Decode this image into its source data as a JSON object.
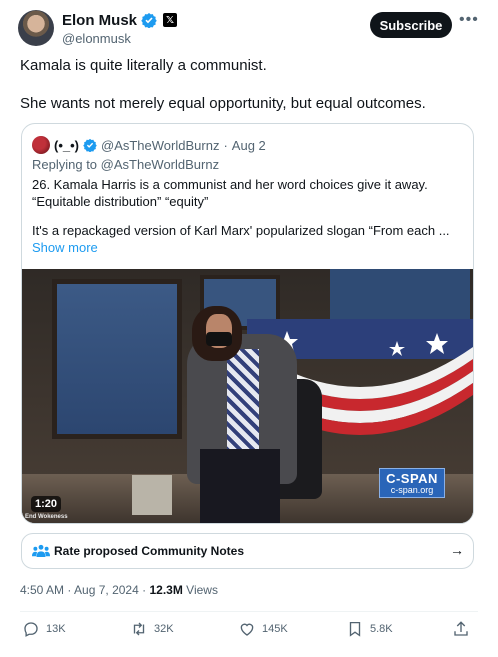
{
  "author": {
    "display_name": "Elon Musk",
    "handle": "@elonmusk",
    "subscribe_label": "Subscribe",
    "more_icon": "more-icon"
  },
  "tweet": {
    "line1": "Kamala is quite literally a communist.",
    "line2": "She wants not merely equal opportunity, but equal outcomes."
  },
  "quote": {
    "name": "(•_•)",
    "handle": "@AsTheWorldBurnz",
    "sep": "·",
    "date": "Aug 2",
    "replying_to": "Replying to @AsTheWorldBurnz",
    "line1": "26. Kamala Harris is a communist and her word choices give it away.",
    "line2": "“Equitable distribution” “equity”",
    "line3": "It's a repackaged version of Karl Marx' popularized slogan “From each ...",
    "show_more": "Show more"
  },
  "video": {
    "timecode": "1:20",
    "watermark": "End Wokeness",
    "cspan_logo": "C-SPAN",
    "cspan_url": "c-span.org"
  },
  "community_notes": {
    "label": "Rate proposed Community Notes",
    "arrow": "→"
  },
  "meta": {
    "time": "4:50 AM",
    "sep": "·",
    "date": "Aug 7, 2024",
    "views_count": "12.3M",
    "views_label": "Views"
  },
  "actions": {
    "replies": "13K",
    "reposts": "32K",
    "likes": "145K",
    "bookmarks": "5.8K"
  },
  "colors": {
    "accent": "#1d9bf0",
    "text": "#0f1419",
    "secondary": "#536471",
    "border": "#cfd9de"
  }
}
